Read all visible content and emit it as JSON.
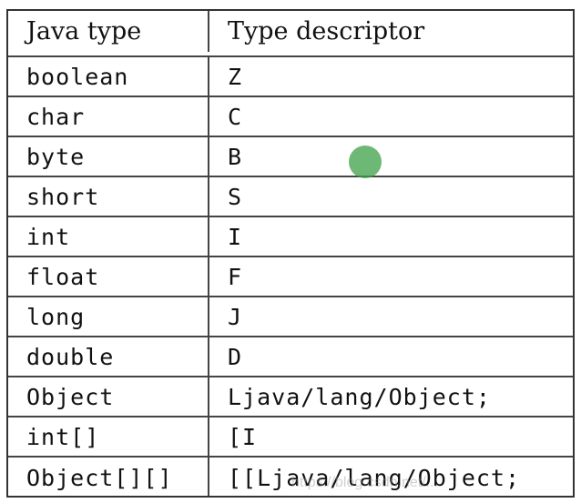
{
  "header": {
    "col1": "Java type",
    "col2": "Type descriptor"
  },
  "rows": [
    {
      "java_type": "boolean",
      "descriptor": "Z"
    },
    {
      "java_type": "char",
      "descriptor": "C"
    },
    {
      "java_type": "byte",
      "descriptor": "B"
    },
    {
      "java_type": "short",
      "descriptor": "S"
    },
    {
      "java_type": "int",
      "descriptor": "I"
    },
    {
      "java_type": "float",
      "descriptor": "F"
    },
    {
      "java_type": "long",
      "descriptor": "J"
    },
    {
      "java_type": "double",
      "descriptor": "D"
    },
    {
      "java_type": "Object",
      "descriptor": "Ljava/lang/Object;"
    },
    {
      "java_type": "int[]",
      "descriptor": "[I"
    },
    {
      "java_type": "Object[][]",
      "descriptor": "[[Ljava/lang/Object;"
    }
  ],
  "watermark": "https://blog.csdn.net/...",
  "cursor_color": "#3ca046"
}
